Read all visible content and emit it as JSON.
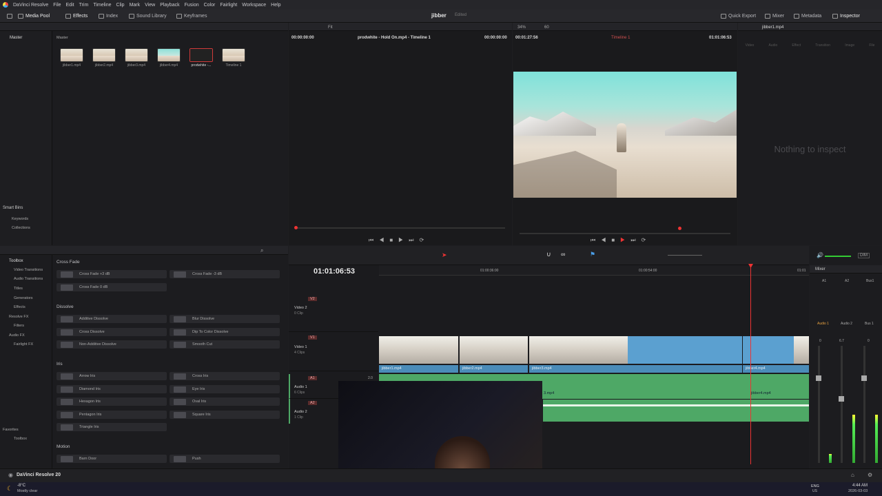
{
  "menubar": {
    "app_name": "DaVinci Resolve",
    "items": [
      "File",
      "Edit",
      "Trim",
      "Timeline",
      "Clip",
      "Mark",
      "View",
      "Playback",
      "Fusion",
      "Color",
      "Fairlight",
      "Workspace",
      "Help"
    ]
  },
  "toolbar": {
    "media_pool": "Media Pool",
    "effects": "Effects",
    "index": "Index",
    "sound_library": "Sound Library",
    "keyframes": "Keyframes",
    "project_title": "jibber",
    "project_status": "Edited",
    "quick_export": "Quick Export",
    "mixer": "Mixer",
    "metadata": "Metadata",
    "inspector": "Inspector"
  },
  "media_pool": {
    "bin_label": "Master",
    "header_label": "Master",
    "clips": [
      {
        "name": "jibber1.mp4"
      },
      {
        "name": "jibber2.mp4"
      },
      {
        "name": "jibber3.mp4"
      },
      {
        "name": "jibber4.mp4"
      },
      {
        "name": "prodwhite -..."
      },
      {
        "name": "Timeline 1"
      }
    ],
    "smart_bins": "Smart Bins",
    "keywords": "Keywords",
    "collections": "Collections"
  },
  "source_viewer": {
    "timecode_left": "00:00:00:00",
    "zoom": "Fit",
    "clip_title": "prodwhite - Hold On.mp4 - Timeline 1",
    "timecode_right": "00:00:00:00"
  },
  "timeline_viewer": {
    "zoom": "34%",
    "fps": "60",
    "duration": "00:01:27:56",
    "timeline_name": "Timeline 1",
    "timecode": "01:01:06:53"
  },
  "inspector": {
    "clip_name": "jibber1.mp4",
    "tabs": [
      "Video",
      "Audio",
      "Effect",
      "Transition",
      "Image",
      "File"
    ],
    "empty_message": "Nothing to inspect"
  },
  "effects_library": {
    "tree": [
      {
        "label": "Toolbox",
        "children": [
          "Video Transitions",
          "Audio Transitions",
          "Titles",
          "Generators",
          "Effects"
        ]
      },
      {
        "label": "Resolve FX",
        "children": [
          "Filters"
        ]
      },
      {
        "label": "Audio FX",
        "children": [
          "Fairlight FX"
        ]
      }
    ],
    "favorites": "Favorites",
    "favorites_toolbox": "Toolbox",
    "sections": [
      {
        "title": "Cross Fade",
        "items": [
          "Cross Fade +3 dB",
          "Cross Fade -3 dB",
          "Cross Fade 0 dB"
        ]
      },
      {
        "title": "Dissolve",
        "items": [
          "Additive Dissolve",
          "Blur Dissolve",
          "Cross Dissolve",
          "Dip To Color Dissolve",
          "Non-Additive Dissolve",
          "Smooth Cut"
        ]
      },
      {
        "title": "Iris",
        "items": [
          "Arrow Iris",
          "Cross Iris",
          "Diamond Iris",
          "Eye Iris",
          "Hexagon Iris",
          "Oval Iris",
          "Pentagon Iris",
          "Square Iris",
          "Triangle Iris"
        ]
      },
      {
        "title": "Motion",
        "items": [
          "Barn Door",
          "Push"
        ]
      }
    ]
  },
  "timeline": {
    "timecode": "01:01:06:53",
    "ruler": [
      "01:00:36:00",
      "01:00:54:00",
      "01:01"
    ],
    "tracks": {
      "v2": {
        "tag": "V2",
        "name": "Video 2",
        "count": "0 Clip"
      },
      "v1": {
        "tag": "V1",
        "name": "Video 1",
        "count": "4 Clips"
      },
      "a1": {
        "tag": "A1",
        "name": "Audio 1",
        "count": "6 Clips",
        "level": "2.0"
      },
      "a2": {
        "tag": "A2",
        "name": "Audio 2",
        "count": "1 Clip"
      }
    },
    "video_clips": [
      "jibber1.mp4",
      "jibber2.mp4",
      "jibber3.mp4",
      "jibber4.mp4"
    ],
    "audio_clips": [
      "3.mp4",
      "jibber4.mp4"
    ]
  },
  "mixer": {
    "title": "Mixer",
    "dim": "DIM",
    "channels": [
      "A1",
      "A2",
      "Bus1"
    ],
    "channel_names": [
      "Audio 1",
      "Audio 2",
      "Bus 1"
    ],
    "gain_readouts": [
      "0",
      "6.7",
      "0"
    ]
  },
  "statusbar": {
    "app_version": "DaVinci Resolve 20"
  },
  "taskbar": {
    "temperature": "-8°C",
    "weather": "Mostly clear",
    "lang": "ENG",
    "region": "US",
    "time": "4:44 AM",
    "date": "2026-03-03"
  }
}
